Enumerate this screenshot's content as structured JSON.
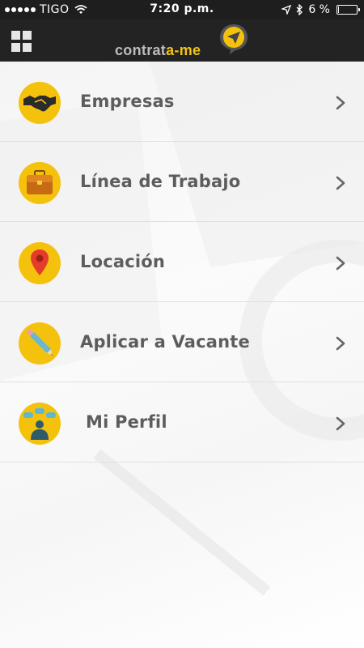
{
  "status_bar": {
    "carrier": "TIGO",
    "time": "7:20 p.m.",
    "battery_text": "6 %",
    "battery_level": 0.06
  },
  "nav": {
    "logo_part1": "contrat",
    "logo_part2": "a-me"
  },
  "menu": {
    "items": [
      {
        "label": "Empresas",
        "icon": "handshake-icon"
      },
      {
        "label": "Línea de Trabajo",
        "icon": "briefcase-icon"
      },
      {
        "label": "Locación",
        "icon": "location-pin-icon"
      },
      {
        "label": "Aplicar a Vacante",
        "icon": "pencil-icon"
      },
      {
        "label": "Mi Perfil",
        "icon": "profile-chat-icon"
      }
    ]
  },
  "colors": {
    "accent_yellow": "#f4c20d",
    "nav_background": "#232323",
    "label_gray": "#5d5d5d"
  }
}
